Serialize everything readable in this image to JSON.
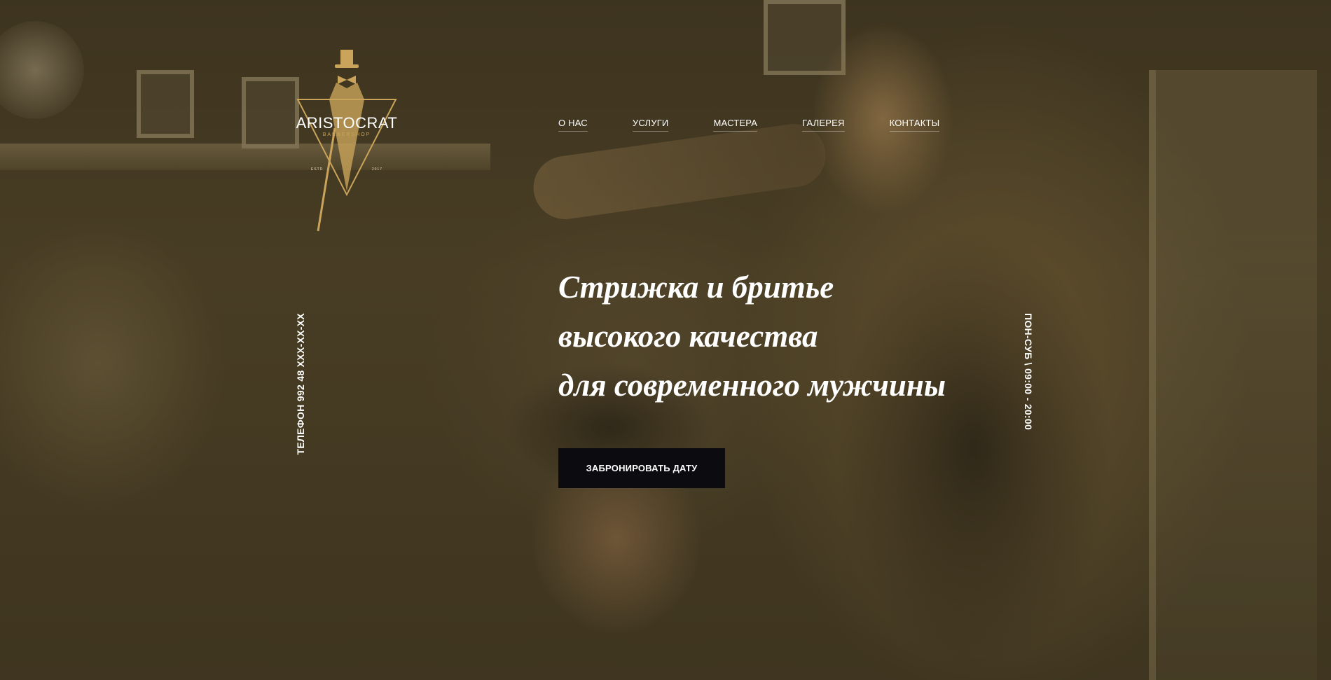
{
  "brand": {
    "name": "ARISTOCRAT",
    "tagline": "BARBERSHOP",
    "est_left": "ESTD",
    "est_right": "2017",
    "accent_color": "#c9a45a"
  },
  "nav": {
    "items": [
      {
        "label": "О НАС"
      },
      {
        "label": "УСЛУГИ"
      },
      {
        "label": "МАСТЕРА"
      },
      {
        "label": "ГАЛЕРЕЯ"
      },
      {
        "label": "КОНТАКТЫ"
      }
    ]
  },
  "contact": {
    "phone_text": "ТЕЛЕФОН 992 48 XXX-XX-XX",
    "hours_text": "ПОН-СУБ \\ 09:00 - 20:00"
  },
  "hero": {
    "headline": [
      "Стрижка и бритье",
      "высокого качества",
      "для современного мужчины"
    ],
    "cta_label": "ЗАБРОНИРОВАТЬ ДАТУ",
    "cta_color": "#0b0b10"
  }
}
